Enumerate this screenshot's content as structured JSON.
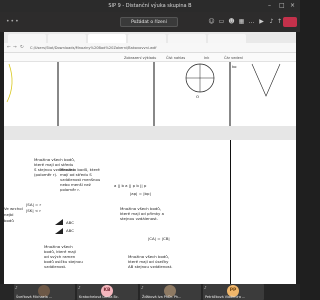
{
  "window": {
    "title": "SIP 9 - Distanční výuka skupina B"
  },
  "meeting": {
    "request_control_label": "Požádat o řízení"
  },
  "browser": {
    "address": "C:/Users/Stat/Downloads/Mnoziny%20Bod%20Zakerni/Bakovovvni.wdf",
    "pdf_tools": [
      "Zobrazení výkladu",
      "Číst nahlas",
      "Ink",
      "Čár vedení"
    ]
  },
  "pdf": {
    "top": {
      "label_a": "ko",
      "label_b": "O"
    },
    "texts": {
      "t1": [
        "Množina všech bodů,",
        "které mají od středu",
        "S stejnou vzdálenost",
        "(poloměr r)."
      ],
      "t2": [
        "Množina bodů, které",
        "mají od středu S",
        "vzdálenost menšnou",
        "nebo menší než",
        "poloměr r."
      ],
      "t3": "a || b   a || p   b || p",
      "t4": "|ap| = |bp|",
      "t5a": "|SA| = r",
      "t5b": "|SK| < r",
      "t6a": "Ve wrchol",
      "t6b": "nejbl",
      "t6c": "bodů",
      "t7": [
        "Množina všech bodů,",
        "které mají od přímky a",
        "stejnou vzdálenost."
      ],
      "t8a": "ABC",
      "t8b": "ABC",
      "t9": [
        "Množina všech",
        "bodů, které mají",
        "od svých ramen",
        "bodů osičku stejnou",
        "vzdálenost."
      ],
      "t10": "|CA| = |CB|",
      "t11": [
        "Množina všech bodů,",
        "které mají od úsečky",
        "AB stejnou vzdálenost."
      ]
    }
  },
  "participants": [
    {
      "name": "Šveřková Michaela ...",
      "initials": "",
      "avatar_color": "#6d5846"
    },
    {
      "name": "Kratochelová Lenka Bc.",
      "initials": "KB",
      "avatar_color": "#f4b6bd"
    },
    {
      "name": "Žďáková Iva PhDr. Ph...",
      "initials": "",
      "avatar_color": "#8e7a63"
    },
    {
      "name": "Petráčková Vladimíra ...",
      "initials": "PP",
      "avatar_color": "#f0b66a"
    }
  ]
}
